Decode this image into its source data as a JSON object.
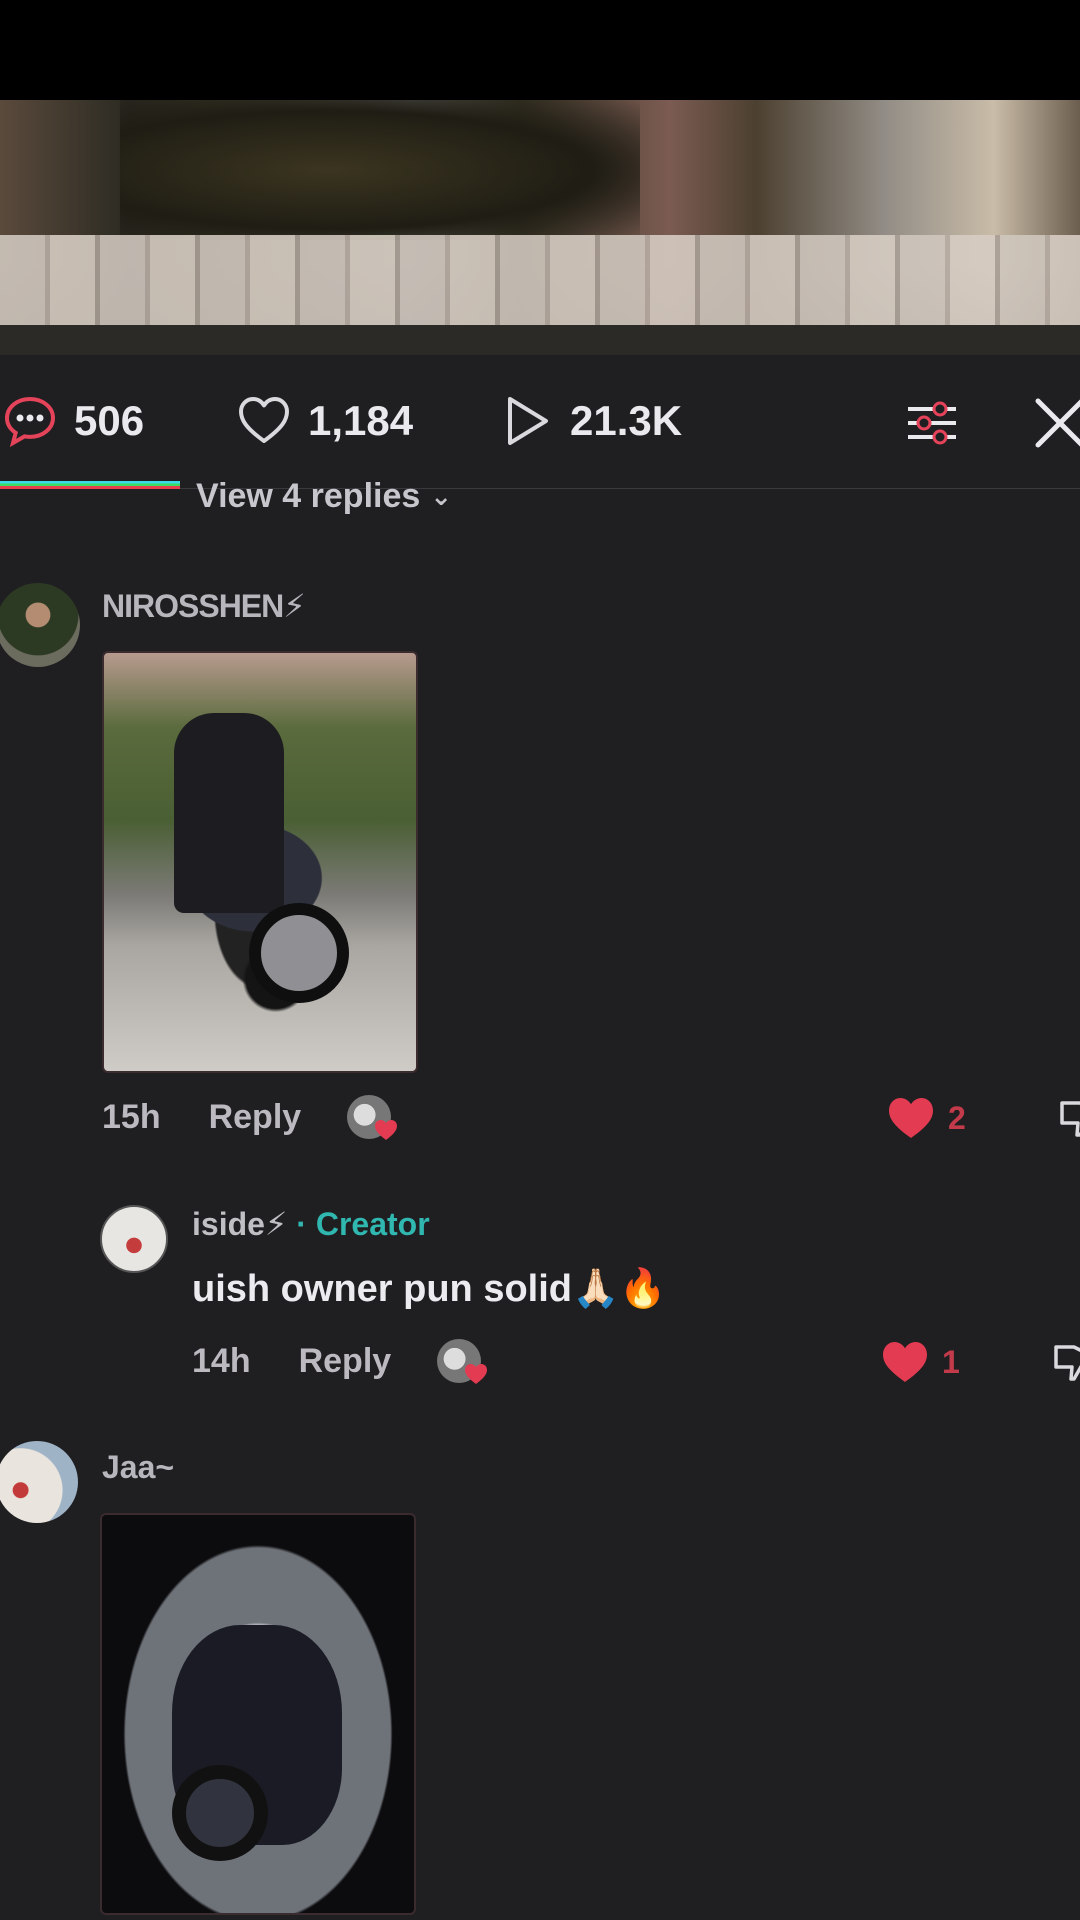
{
  "video": {},
  "stats": {
    "comments": "506",
    "likes": "1,184",
    "views": "21.3K"
  },
  "thread": {
    "view_replies": "View 4 replies",
    "chevron": "⌄"
  },
  "comments": [
    {
      "username": "NIROSSHEN⚡",
      "time": "15h",
      "reply_label": "Reply",
      "like_count": "2",
      "has_image": true
    },
    {
      "username": "iside⚡",
      "creator_tag": " · Creator",
      "text": "uish owner pun solid🙏🏻🔥",
      "time": "14h",
      "reply_label": "Reply",
      "like_count": "1"
    },
    {
      "username": "Jaa~",
      "has_image": true
    }
  ],
  "colors": {
    "background": "#1f1e21",
    "accent_heart": "#e23b52",
    "creator": "#2fb7b0"
  },
  "icons": {
    "comments": "comment-bubble-icon",
    "likes": "heart-outline-icon",
    "views": "play-icon",
    "filter": "sliders-icon",
    "close": "close-icon",
    "heart": "heart-filled-icon",
    "dislike": "thumbs-down-icon"
  }
}
